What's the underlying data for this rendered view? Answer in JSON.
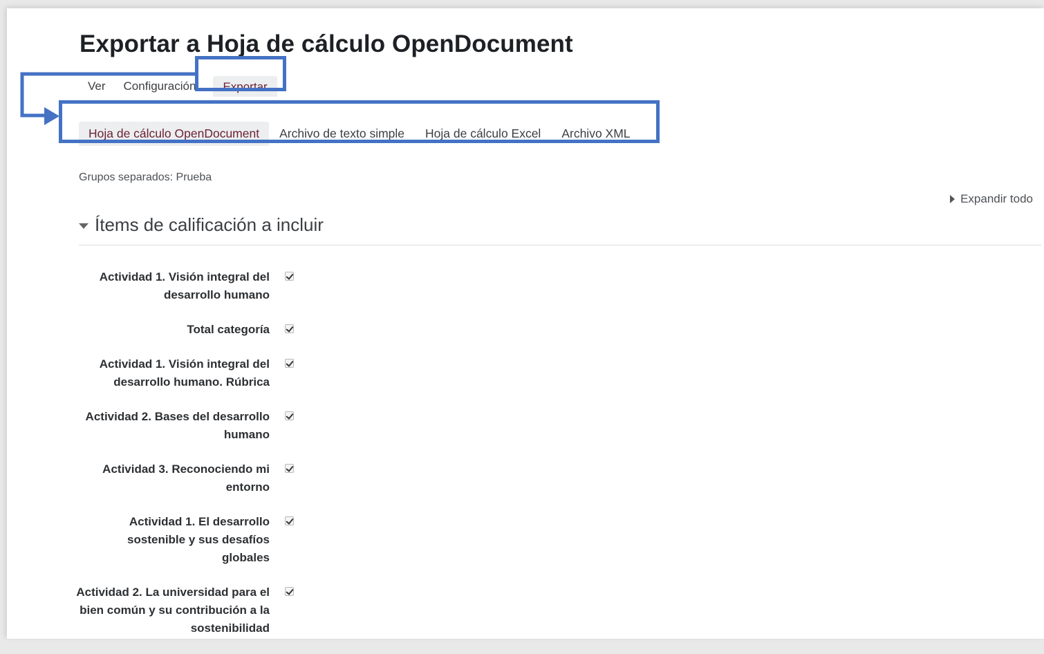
{
  "page": {
    "title": "Exportar a Hoja de cálculo OpenDocument"
  },
  "primary_tabs": [
    {
      "label": "Ver",
      "active": false
    },
    {
      "label": "Configuración",
      "active": false
    },
    {
      "label": "Exportar",
      "active": true
    }
  ],
  "export_tabs": [
    {
      "label": "Hoja de cálculo OpenDocument",
      "active": true
    },
    {
      "label": "Archivo de texto simple",
      "active": false
    },
    {
      "label": "Hoja de cálculo Excel",
      "active": false
    },
    {
      "label": "Archivo XML",
      "active": false
    }
  ],
  "groups_line": "Grupos separados: Prueba",
  "expand_all_label": "Expandir todo",
  "section": {
    "title": "Ítems de calificación a incluir",
    "items": [
      {
        "label": "Actividad 1. Visión integral del desarrollo humano",
        "checked": true
      },
      {
        "label": "Total categoría",
        "checked": true
      },
      {
        "label": "Actividad 1. Visión integral del desarrollo humano. Rúbrica",
        "checked": true
      },
      {
        "label": "Actividad 2. Bases del desarrollo humano",
        "checked": true
      },
      {
        "label": "Actividad 3. Reconociendo mi entorno",
        "checked": true
      },
      {
        "label": "Actividad 1. El desarrollo sostenible y sus desafíos globales",
        "checked": true
      },
      {
        "label": "Actividad 2. La universidad para el bien común y su contribución a la sostenibilidad",
        "checked": true
      }
    ]
  },
  "colors": {
    "highlight": "#4472c4",
    "active_tab_text": "#6b2334"
  }
}
